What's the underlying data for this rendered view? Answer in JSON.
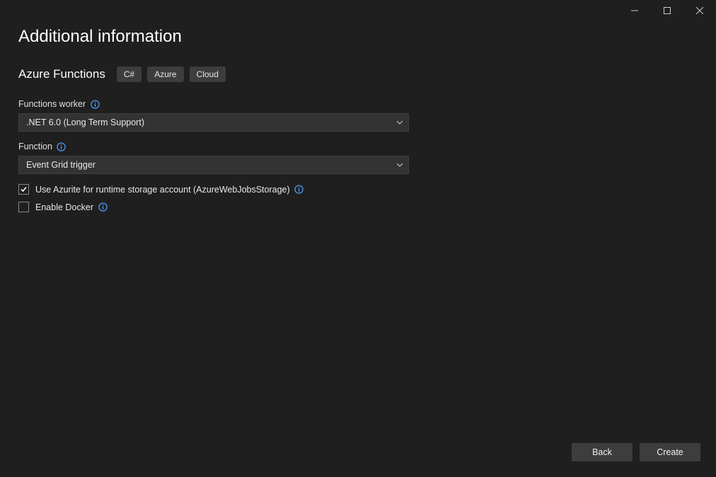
{
  "header": {
    "title": "Additional information"
  },
  "project": {
    "subtitle": "Azure Functions",
    "tags": [
      "C#",
      "Azure",
      "Cloud"
    ]
  },
  "fields": {
    "worker": {
      "label": "Functions worker",
      "value": ".NET 6.0 (Long Term Support)"
    },
    "function": {
      "label": "Function",
      "value": "Event Grid trigger"
    }
  },
  "checkboxes": {
    "azurite": {
      "label": "Use Azurite for runtime storage account (AzureWebJobsStorage)",
      "checked": true
    },
    "docker": {
      "label": "Enable Docker",
      "checked": false
    }
  },
  "footer": {
    "back": "Back",
    "create": "Create"
  }
}
